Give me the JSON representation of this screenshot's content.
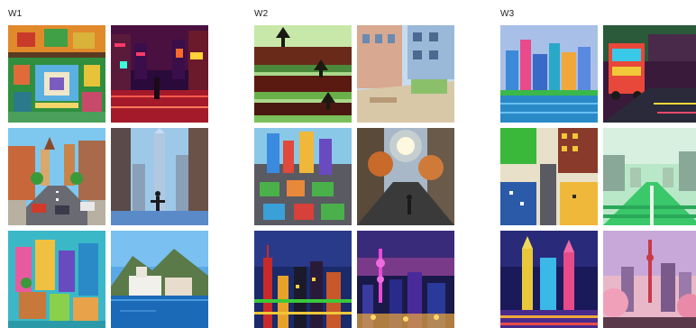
{
  "groups": [
    {
      "label": "W1"
    },
    {
      "label": "W2"
    },
    {
      "label": "W3"
    }
  ],
  "colors": {
    "background": "#ffffff",
    "label_text": "#222222"
  }
}
